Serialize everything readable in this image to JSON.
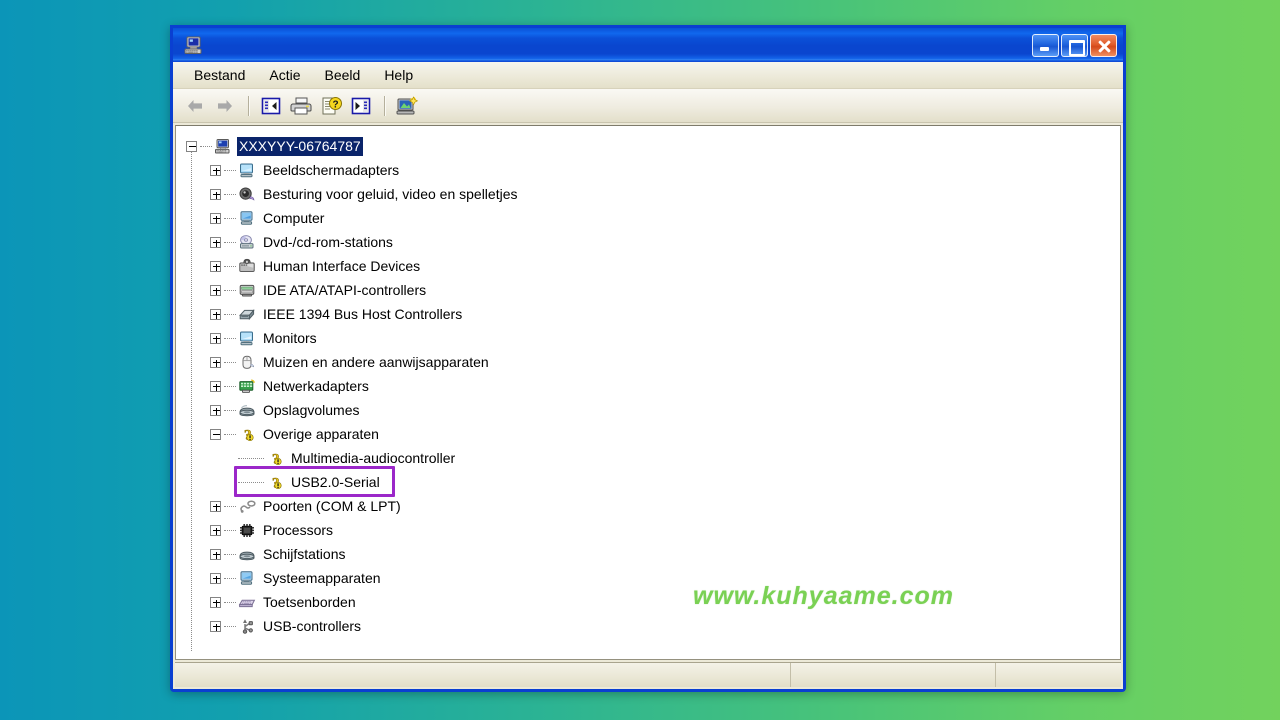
{
  "desktop": {
    "bg_left": "#0b95b8",
    "bg_right": "#72d25d",
    "watermark": "www.kuhyaame.com",
    "watermark_color": "#7ad154"
  },
  "window": {
    "title": "",
    "icon": "device-manager-icon",
    "accent": "#0a46cf",
    "buttons": {
      "minimize": "Minimize",
      "maximize": "Maximize",
      "close": "Close"
    }
  },
  "menubar": {
    "items": [
      {
        "label": "Bestand"
      },
      {
        "label": "Actie"
      },
      {
        "label": "Beeld"
      },
      {
        "label": "Help"
      }
    ]
  },
  "toolbar": {
    "items": [
      {
        "name": "back-button",
        "icon": "arrow-left-icon",
        "tooltip": "Vorige"
      },
      {
        "name": "forward-button",
        "icon": "arrow-right-icon",
        "tooltip": "Volgende"
      },
      {
        "name": "separator-1",
        "icon": "separator",
        "tooltip": ""
      },
      {
        "name": "show-hide-console-tree-button",
        "icon": "console-tree-icon",
        "tooltip": "Consolestructuur tonen/verbergen"
      },
      {
        "name": "print-button",
        "icon": "printer-icon",
        "tooltip": "Afdrukken"
      },
      {
        "name": "properties-button",
        "icon": "properties-help-icon",
        "tooltip": "Eigenschappen"
      },
      {
        "name": "update-driver-button",
        "icon": "update-driver-icon",
        "tooltip": "Stuurprogramma bijwerken"
      },
      {
        "name": "separator-2",
        "icon": "separator",
        "tooltip": ""
      },
      {
        "name": "scan-hardware-changes-button",
        "icon": "scan-hardware-icon",
        "tooltip": "Zoeken naar gewijzigde apparaten"
      }
    ]
  },
  "tree": {
    "root": {
      "label": "XXXYYY-06764787",
      "icon": "computer-icon",
      "expanded": true,
      "selected": true
    },
    "nodes": [
      {
        "label": "Beeldschermadapters",
        "icon": "display-adapter-icon",
        "expanded": false,
        "level": 1
      },
      {
        "label": "Besturing voor geluid, video en spelletjes",
        "icon": "sound-video-game-icon",
        "expanded": false,
        "level": 1
      },
      {
        "label": "Computer",
        "icon": "computer-node-icon",
        "expanded": false,
        "level": 1
      },
      {
        "label": "Dvd-/cd-rom-stations",
        "icon": "dvd-drive-icon",
        "expanded": false,
        "level": 1
      },
      {
        "label": "Human Interface Devices",
        "icon": "hid-icon",
        "expanded": false,
        "level": 1
      },
      {
        "label": "IDE ATA/ATAPI-controllers",
        "icon": "ide-controller-icon",
        "expanded": false,
        "level": 1
      },
      {
        "label": "IEEE 1394 Bus Host Controllers",
        "icon": "ieee1394-icon",
        "expanded": false,
        "level": 1
      },
      {
        "label": "Monitors",
        "icon": "monitor-icon",
        "expanded": false,
        "level": 1
      },
      {
        "label": "Muizen en andere aanwijsapparaten",
        "icon": "mouse-icon",
        "expanded": false,
        "level": 1
      },
      {
        "label": "Netwerkadapters",
        "icon": "network-adapter-icon",
        "expanded": false,
        "level": 1
      },
      {
        "label": "Opslagvolumes",
        "icon": "storage-volume-icon",
        "expanded": false,
        "level": 1
      },
      {
        "label": "Overige apparaten",
        "icon": "unknown-device-icon",
        "expanded": true,
        "level": 1
      },
      {
        "label": "Multimedia-audiocontroller",
        "icon": "unknown-device-icon",
        "expanded": null,
        "level": 2
      },
      {
        "label": "USB2.0-Serial",
        "icon": "unknown-device-icon",
        "expanded": null,
        "level": 2,
        "highlighted": true
      },
      {
        "label": "Poorten (COM & LPT)",
        "icon": "port-icon",
        "expanded": false,
        "level": 1
      },
      {
        "label": "Processors",
        "icon": "processor-icon",
        "expanded": false,
        "level": 1
      },
      {
        "label": "Schijfstations",
        "icon": "disk-drive-icon",
        "expanded": false,
        "level": 1
      },
      {
        "label": "Systeemapparaten",
        "icon": "system-device-icon",
        "expanded": false,
        "level": 1
      },
      {
        "label": "Toetsenborden",
        "icon": "keyboard-icon",
        "expanded": false,
        "level": 1
      },
      {
        "label": "USB-controllers",
        "icon": "usb-controller-icon",
        "expanded": false,
        "level": 1
      }
    ],
    "highlight_color": "#9b27c9",
    "selection_color": "#0a246a"
  },
  "statusbar": {
    "panes": [
      "",
      "",
      ""
    ]
  }
}
